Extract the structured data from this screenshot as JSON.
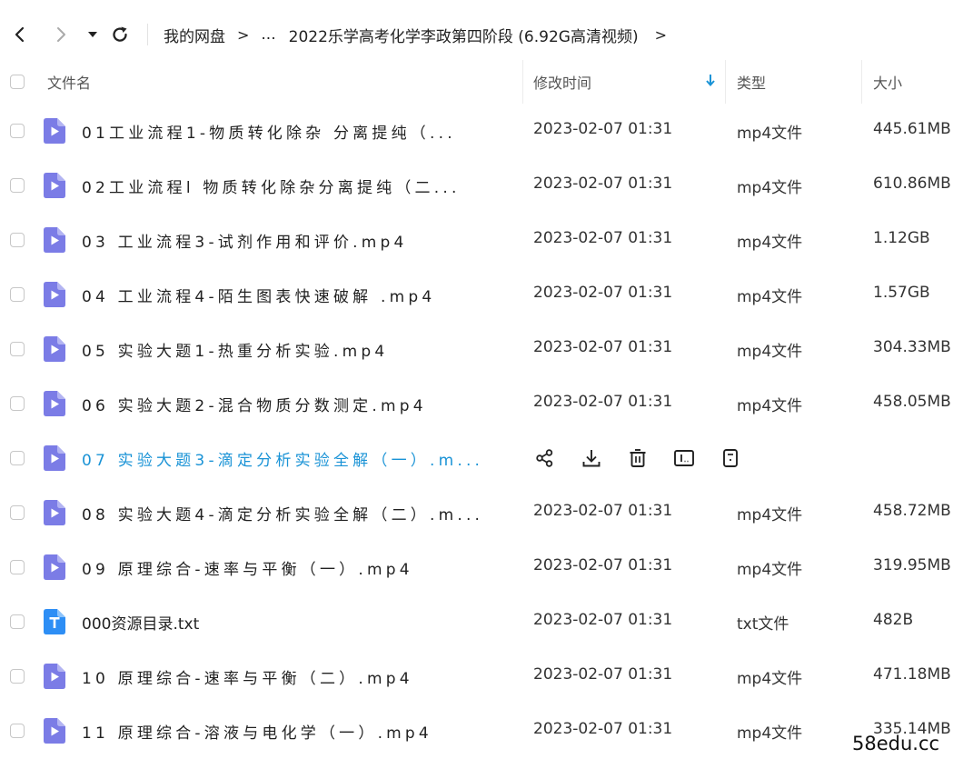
{
  "nav": {
    "breadcrumb": [
      "我的网盘",
      "...",
      "2022乐学高考化学李政第四阶段 (6.92G高清视频)"
    ],
    "separator": ">"
  },
  "columns": {
    "name": "文件名",
    "modified": "修改时间",
    "type": "类型",
    "size": "大小"
  },
  "sort_icon": "arrow-down-icon",
  "colors": {
    "accent": "#1a93d6",
    "video_icon": "#7b7ce6",
    "txt_icon": "#2d8ef5"
  },
  "row_actions": [
    "share-icon",
    "download-icon",
    "delete-icon",
    "rename-icon",
    "more-icon"
  ],
  "files": [
    {
      "name": "01工业流程1-物质转化除杂 分离提纯（...",
      "modified": "2023-02-07 01:31",
      "type": "mp4文件",
      "size": "445.61MB",
      "icon": "video-file-icon"
    },
    {
      "name": "02工业流程l 物质转化除杂分离提纯（二...",
      "modified": "2023-02-07 01:31",
      "type": "mp4文件",
      "size": "610.86MB",
      "icon": "video-file-icon"
    },
    {
      "name": "03 工业流程3-试剂作用和评价.mp4",
      "modified": "2023-02-07 01:31",
      "type": "mp4文件",
      "size": "1.12GB",
      "icon": "video-file-icon"
    },
    {
      "name": "04 工业流程4-陌生图表快速破解 .mp4",
      "modified": "2023-02-07 01:31",
      "type": "mp4文件",
      "size": "1.57GB",
      "icon": "video-file-icon"
    },
    {
      "name": "05 实验大题1-热重分析实验.mp4",
      "modified": "2023-02-07 01:31",
      "type": "mp4文件",
      "size": "304.33MB",
      "icon": "video-file-icon"
    },
    {
      "name": "06 实验大题2-混合物质分数测定.mp4",
      "modified": "2023-02-07 01:31",
      "type": "mp4文件",
      "size": "458.05MB",
      "icon": "video-file-icon"
    },
    {
      "name": "07 实验大题3-滴定分析实验全解（一）.m...",
      "modified": "",
      "type": "",
      "size": "",
      "icon": "video-file-icon",
      "hover": true
    },
    {
      "name": "08 实验大题4-滴定分析实验全解（二）.m...",
      "modified": "2023-02-07 01:31",
      "type": "mp4文件",
      "size": "458.72MB",
      "icon": "video-file-icon"
    },
    {
      "name": "09 原理综合-速率与平衡（一）.mp4",
      "modified": "2023-02-07 01:31",
      "type": "mp4文件",
      "size": "319.95MB",
      "icon": "video-file-icon"
    },
    {
      "name": "000资源目录.txt",
      "modified": "2023-02-07 01:31",
      "type": "txt文件",
      "size": "482B",
      "icon": "text-file-icon"
    },
    {
      "name": "10 原理综合-速率与平衡（二）.mp4",
      "modified": "2023-02-07 01:31",
      "type": "mp4文件",
      "size": "471.18MB",
      "icon": "video-file-icon"
    },
    {
      "name": "11 原理综合-溶液与电化学（一）.mp4",
      "modified": "2023-02-07 01:31",
      "type": "mp4文件",
      "size": "335.14MB",
      "icon": "video-file-icon"
    }
  ],
  "watermark": "58edu.cc"
}
